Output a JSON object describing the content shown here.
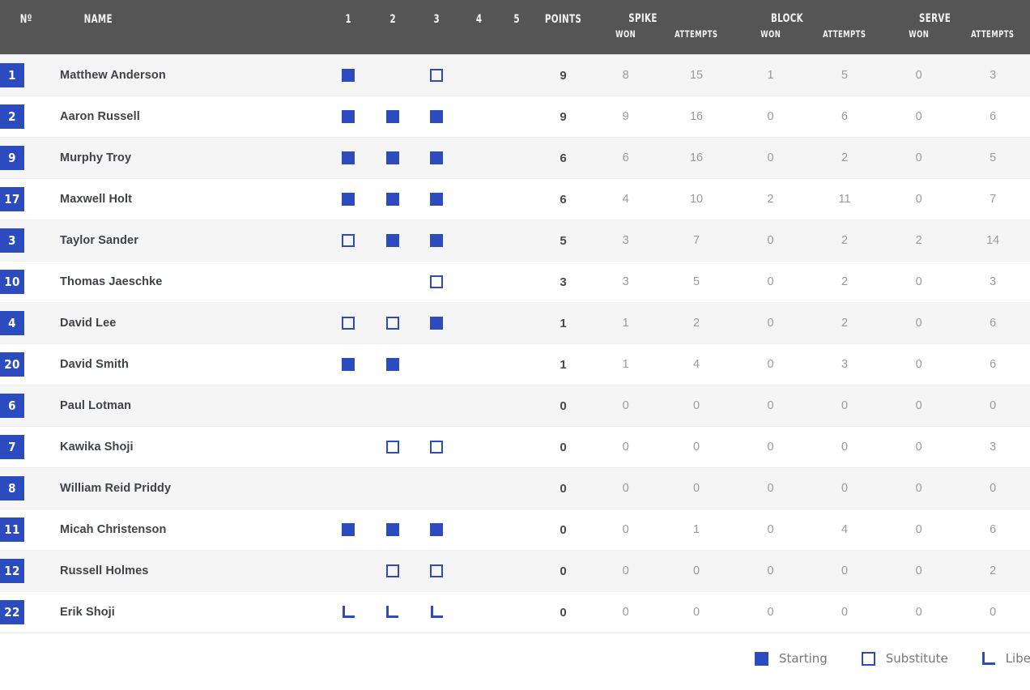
{
  "header": {
    "number": "Nº",
    "name": "NAME",
    "sets": [
      "1",
      "2",
      "3",
      "4",
      "5"
    ],
    "points": "POINTS",
    "groups": [
      {
        "title": "SPIKE",
        "won": "WON",
        "attempts": "ATTEMPTS"
      },
      {
        "title": "BLOCK",
        "won": "WON",
        "attempts": "ATTEMPTS"
      },
      {
        "title": "SERVE",
        "won": "WON",
        "attempts": "ATTEMPTS"
      }
    ]
  },
  "legend": {
    "starting": "Starting",
    "substitute": "Substitute",
    "libero": "Libero"
  },
  "colors": {
    "accent": "#2b4bbf",
    "header_bg": "#555555",
    "row_odd": "#f5f5f5",
    "row_even": "#ffffff"
  },
  "players": [
    {
      "number": "1",
      "name": "Matthew Anderson",
      "sets": [
        "starting",
        "none",
        "substitute",
        "none",
        "none"
      ],
      "points": "9",
      "spike_won": "8",
      "spike_attempts": "15",
      "block_won": "1",
      "block_attempts": "5",
      "serve_won": "0",
      "serve_attempts": "3"
    },
    {
      "number": "2",
      "name": "Aaron Russell",
      "sets": [
        "starting",
        "starting",
        "starting",
        "none",
        "none"
      ],
      "points": "9",
      "spike_won": "9",
      "spike_attempts": "16",
      "block_won": "0",
      "block_attempts": "6",
      "serve_won": "0",
      "serve_attempts": "6"
    },
    {
      "number": "9",
      "name": "Murphy Troy",
      "sets": [
        "starting",
        "starting",
        "starting",
        "none",
        "none"
      ],
      "points": "6",
      "spike_won": "6",
      "spike_attempts": "16",
      "block_won": "0",
      "block_attempts": "2",
      "serve_won": "0",
      "serve_attempts": "5"
    },
    {
      "number": "17",
      "name": "Maxwell Holt",
      "sets": [
        "starting",
        "starting",
        "starting",
        "none",
        "none"
      ],
      "points": "6",
      "spike_won": "4",
      "spike_attempts": "10",
      "block_won": "2",
      "block_attempts": "11",
      "serve_won": "0",
      "serve_attempts": "7"
    },
    {
      "number": "3",
      "name": "Taylor Sander",
      "sets": [
        "substitute",
        "starting",
        "starting",
        "none",
        "none"
      ],
      "points": "5",
      "spike_won": "3",
      "spike_attempts": "7",
      "block_won": "0",
      "block_attempts": "2",
      "serve_won": "2",
      "serve_attempts": "14"
    },
    {
      "number": "10",
      "name": "Thomas Jaeschke",
      "sets": [
        "none",
        "none",
        "substitute",
        "none",
        "none"
      ],
      "points": "3",
      "spike_won": "3",
      "spike_attempts": "5",
      "block_won": "0",
      "block_attempts": "2",
      "serve_won": "0",
      "serve_attempts": "3"
    },
    {
      "number": "4",
      "name": "David Lee",
      "sets": [
        "substitute",
        "substitute",
        "starting",
        "none",
        "none"
      ],
      "points": "1",
      "spike_won": "1",
      "spike_attempts": "2",
      "block_won": "0",
      "block_attempts": "2",
      "serve_won": "0",
      "serve_attempts": "6"
    },
    {
      "number": "20",
      "name": "David Smith",
      "sets": [
        "starting",
        "starting",
        "none",
        "none",
        "none"
      ],
      "points": "1",
      "spike_won": "1",
      "spike_attempts": "4",
      "block_won": "0",
      "block_attempts": "3",
      "serve_won": "0",
      "serve_attempts": "6"
    },
    {
      "number": "6",
      "name": "Paul Lotman",
      "sets": [
        "none",
        "none",
        "none",
        "none",
        "none"
      ],
      "points": "0",
      "spike_won": "0",
      "spike_attempts": "0",
      "block_won": "0",
      "block_attempts": "0",
      "serve_won": "0",
      "serve_attempts": "0"
    },
    {
      "number": "7",
      "name": "Kawika Shoji",
      "sets": [
        "none",
        "substitute",
        "substitute",
        "none",
        "none"
      ],
      "points": "0",
      "spike_won": "0",
      "spike_attempts": "0",
      "block_won": "0",
      "block_attempts": "0",
      "serve_won": "0",
      "serve_attempts": "3"
    },
    {
      "number": "8",
      "name": "William Reid Priddy",
      "sets": [
        "none",
        "none",
        "none",
        "none",
        "none"
      ],
      "points": "0",
      "spike_won": "0",
      "spike_attempts": "0",
      "block_won": "0",
      "block_attempts": "0",
      "serve_won": "0",
      "serve_attempts": "0"
    },
    {
      "number": "11",
      "name": "Micah Christenson",
      "sets": [
        "starting",
        "starting",
        "starting",
        "none",
        "none"
      ],
      "points": "0",
      "spike_won": "0",
      "spike_attempts": "1",
      "block_won": "0",
      "block_attempts": "4",
      "serve_won": "0",
      "serve_attempts": "6"
    },
    {
      "number": "12",
      "name": "Russell Holmes",
      "sets": [
        "none",
        "substitute",
        "substitute",
        "none",
        "none"
      ],
      "points": "0",
      "spike_won": "0",
      "spike_attempts": "0",
      "block_won": "0",
      "block_attempts": "0",
      "serve_won": "0",
      "serve_attempts": "2"
    },
    {
      "number": "22",
      "name": "Erik Shoji",
      "sets": [
        "libero",
        "libero",
        "libero",
        "none",
        "none"
      ],
      "points": "0",
      "spike_won": "0",
      "spike_attempts": "0",
      "block_won": "0",
      "block_attempts": "0",
      "serve_won": "0",
      "serve_attempts": "0"
    }
  ]
}
